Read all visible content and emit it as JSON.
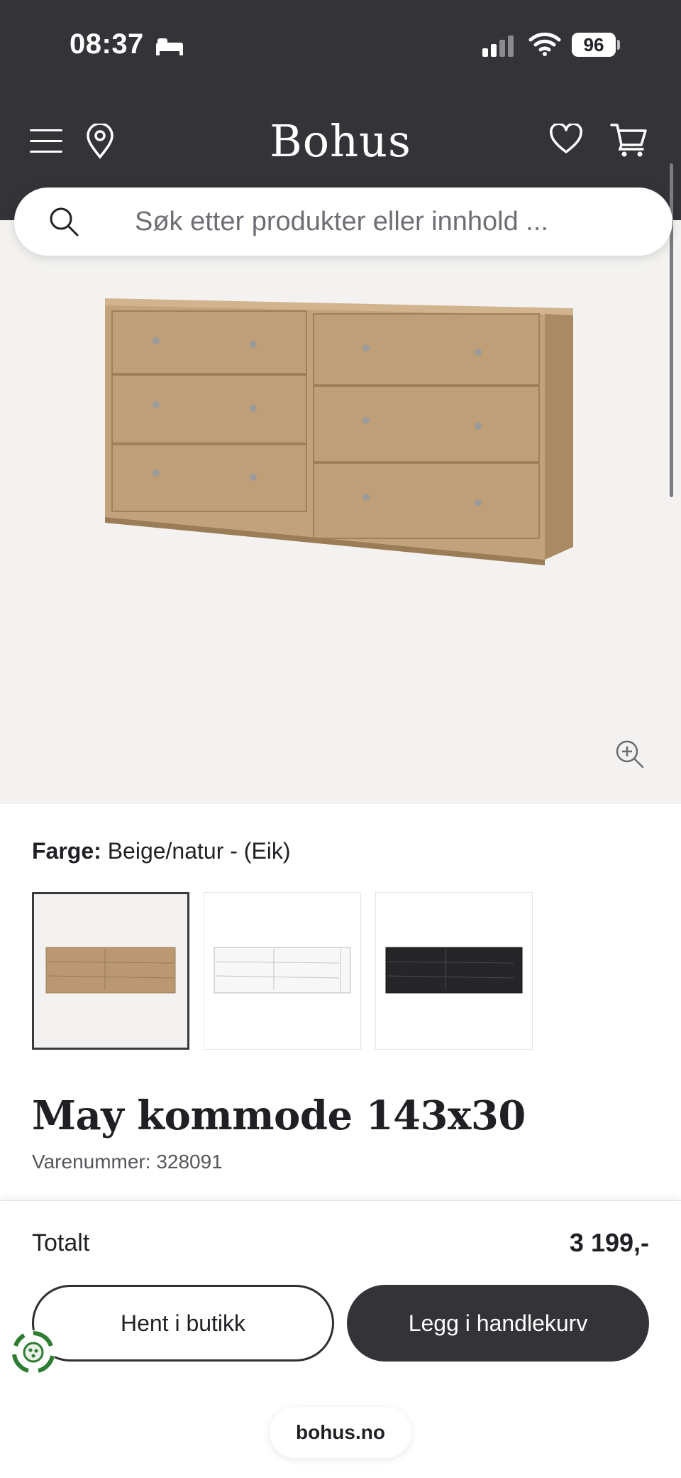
{
  "status_bar": {
    "time": "08:37",
    "battery": "96"
  },
  "header": {
    "logo": "Bohus"
  },
  "search": {
    "placeholder": "Søk etter produkter eller innhold ..."
  },
  "product": {
    "color_label": "Farge:",
    "color_value": "Beige/natur - (Eik)",
    "variants": [
      {
        "name": "oak-dresser",
        "color": "#b4946c",
        "selected": true
      },
      {
        "name": "white-dresser",
        "color": "#f4f4f4",
        "selected": false
      },
      {
        "name": "black-dresser",
        "color": "#262628",
        "selected": false
      }
    ],
    "title": "May kommode 143x30",
    "sku": "Varenummer: 328091"
  },
  "checkout": {
    "total_label": "Totalt",
    "total_price": "3 199,-",
    "pickup_label": "Hent i butikk",
    "add_to_cart_label": "Legg i handlekurv"
  },
  "browser": {
    "url": "bohus.no"
  },
  "colors": {
    "header_bg": "#333338",
    "hero_bg": "#f3f2f0",
    "accent_button": "#333338"
  }
}
